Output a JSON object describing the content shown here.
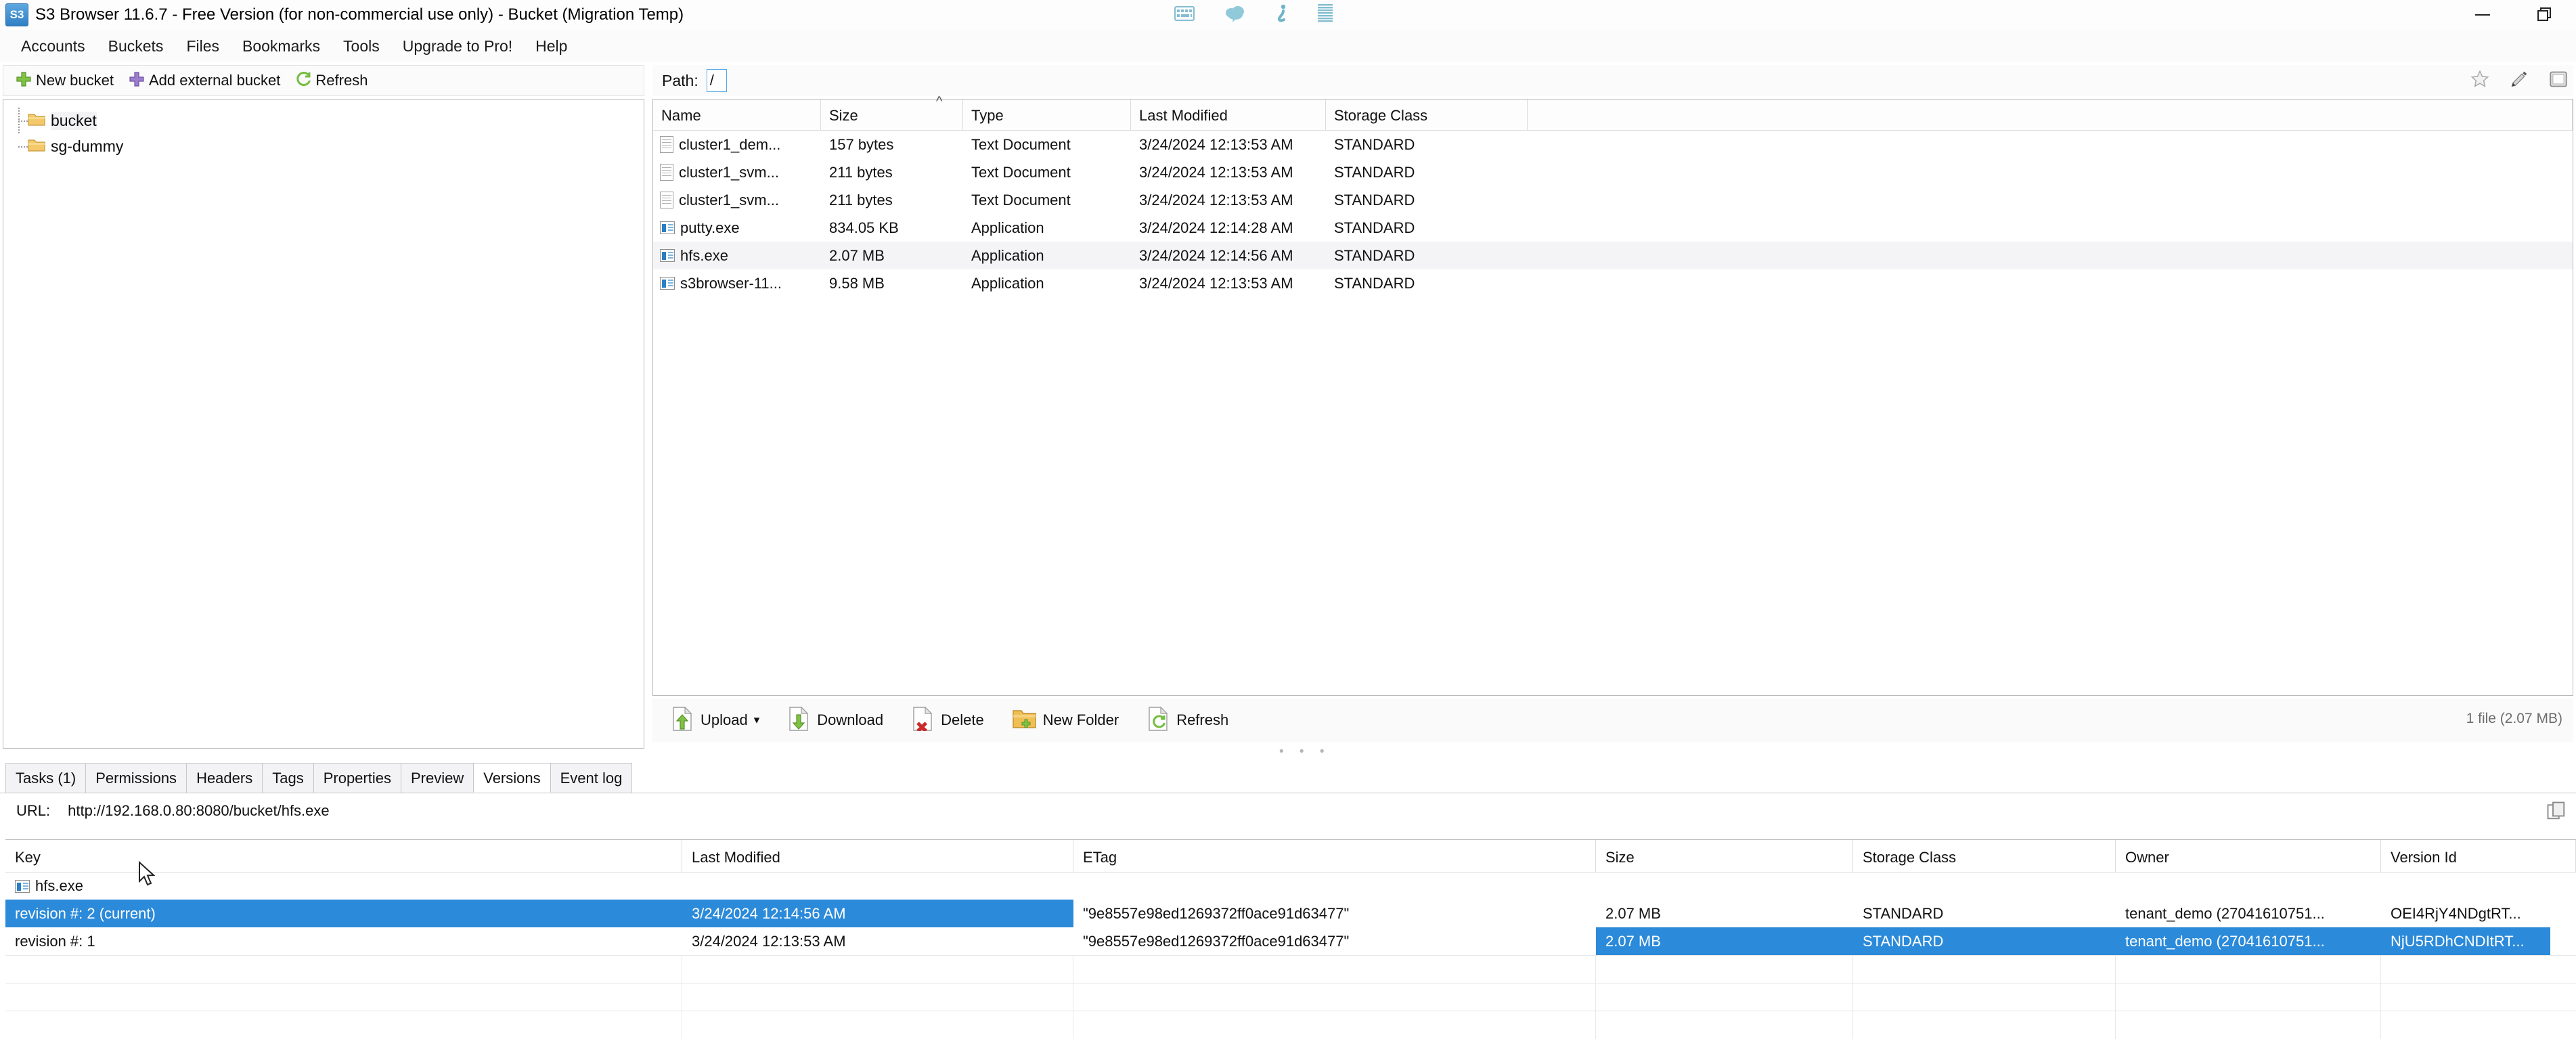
{
  "window": {
    "title": "S3 Browser 11.6.7 - Free Version (for non-commercial use only) - Bucket (Migration Temp)",
    "app_icon_text": "S3",
    "minimize_label": "—",
    "restore_label": "❐"
  },
  "overlay_icons": [
    "keyboard-icon",
    "cloud-icon",
    "info-icon",
    "list-icon"
  ],
  "menubar": {
    "items": [
      {
        "label": "Accounts"
      },
      {
        "label": "Buckets"
      },
      {
        "label": "Files"
      },
      {
        "label": "Bookmarks"
      },
      {
        "label": "Tools"
      },
      {
        "label": "Upgrade to Pro!"
      },
      {
        "label": "Help"
      }
    ]
  },
  "left_toolbar": {
    "buttons": [
      {
        "label": "New bucket",
        "icon": "plus-green-icon"
      },
      {
        "label": "Add external bucket",
        "icon": "plus-purple-icon"
      },
      {
        "label": "Refresh",
        "icon": "refresh-icon"
      }
    ]
  },
  "tree": {
    "items": [
      {
        "label": "bucket",
        "selected": true
      },
      {
        "label": "sg-dummy",
        "selected": false
      }
    ]
  },
  "path": {
    "label": "Path:",
    "value": "/",
    "icons": [
      "star-icon",
      "pencil-icon",
      "window-icon"
    ]
  },
  "file_list": {
    "columns": [
      "Name",
      "Size",
      "Type",
      "Last Modified",
      "Storage Class"
    ],
    "sort_indicator_column": "Size",
    "rows": [
      {
        "name": "cluster1_dem...",
        "size": "157 bytes",
        "type": "Text Document",
        "modified": "3/24/2024 12:13:53 AM",
        "storage": "STANDARD",
        "icon": "text-document-icon",
        "highlighted": false
      },
      {
        "name": "cluster1_svm...",
        "size": "211 bytes",
        "type": "Text Document",
        "modified": "3/24/2024 12:13:53 AM",
        "storage": "STANDARD",
        "icon": "text-document-icon",
        "highlighted": false
      },
      {
        "name": "cluster1_svm...",
        "size": "211 bytes",
        "type": "Text Document",
        "modified": "3/24/2024 12:13:53 AM",
        "storage": "STANDARD",
        "icon": "text-document-icon",
        "highlighted": false
      },
      {
        "name": "putty.exe",
        "size": "834.05 KB",
        "type": "Application",
        "modified": "3/24/2024 12:14:28 AM",
        "storage": "STANDARD",
        "icon": "application-icon",
        "highlighted": false
      },
      {
        "name": "hfs.exe",
        "size": "2.07 MB",
        "type": "Application",
        "modified": "3/24/2024 12:14:56 AM",
        "storage": "STANDARD",
        "icon": "application-icon",
        "highlighted": true
      },
      {
        "name": "s3browser-11...",
        "size": "9.58 MB",
        "type": "Application",
        "modified": "3/24/2024 12:13:53 AM",
        "storage": "STANDARD",
        "icon": "application-icon",
        "highlighted": false
      }
    ]
  },
  "file_actions": {
    "buttons": [
      {
        "label": "Upload",
        "icon": "upload-icon",
        "has_dropdown": true,
        "caret": "▾"
      },
      {
        "label": "Download",
        "icon": "download-icon",
        "has_dropdown": false
      },
      {
        "label": "Delete",
        "icon": "delete-icon",
        "has_dropdown": false
      },
      {
        "label": "New Folder",
        "icon": "new-folder-icon",
        "has_dropdown": false
      },
      {
        "label": "Refresh",
        "icon": "refresh-icon",
        "has_dropdown": false
      }
    ],
    "status": "1 file (2.07 MB)"
  },
  "tabs": {
    "items": [
      {
        "label": "Tasks (1)",
        "active": false
      },
      {
        "label": "Permissions",
        "active": false
      },
      {
        "label": "Headers",
        "active": false
      },
      {
        "label": "Tags",
        "active": false
      },
      {
        "label": "Properties",
        "active": false
      },
      {
        "label": "Preview",
        "active": false
      },
      {
        "label": "Versions",
        "active": true
      },
      {
        "label": "Event log",
        "active": false
      }
    ]
  },
  "url_row": {
    "label": "URL:",
    "value": "http://192.168.0.80:8080/bucket/hfs.exe",
    "copy_icon": "copy-icon"
  },
  "versions": {
    "columns": [
      "Key",
      "Last Modified",
      "ETag",
      "Size",
      "Storage Class",
      "Owner",
      "Version Id"
    ],
    "object_name": "hfs.exe",
    "object_icon": "application-icon",
    "rows": [
      {
        "key": "revision #: 2 (current)",
        "modified": "3/24/2024 12:14:56 AM",
        "etag_sel": "\"9e8557e98ed1269372ff0ace91",
        "etag_rest": "d63477\"",
        "size": "2.07 MB",
        "storage": "STANDARD",
        "owner": "tenant_demo (27041610751...",
        "version_id": "OEI4RjY4NDgtRT...",
        "select_left": true
      },
      {
        "key": "revision #: 1",
        "modified": "3/24/2024 12:13:53 AM",
        "etag_sel": "\"9e8557e98ed1269372ff0ace91",
        "etag_rest": "d63477\"",
        "size": "2.07 MB",
        "storage": "STANDARD",
        "owner": "tenant_demo (27041610751...",
        "version_id": "NjU5RDhCNDItRT...",
        "select_left": false
      }
    ]
  },
  "colors": {
    "selection_blue": "#2b8ad9",
    "accent_blue": "#2a7ec4",
    "row_highlight": "#f4f4f6",
    "panel_border": "#b9b9bd"
  }
}
